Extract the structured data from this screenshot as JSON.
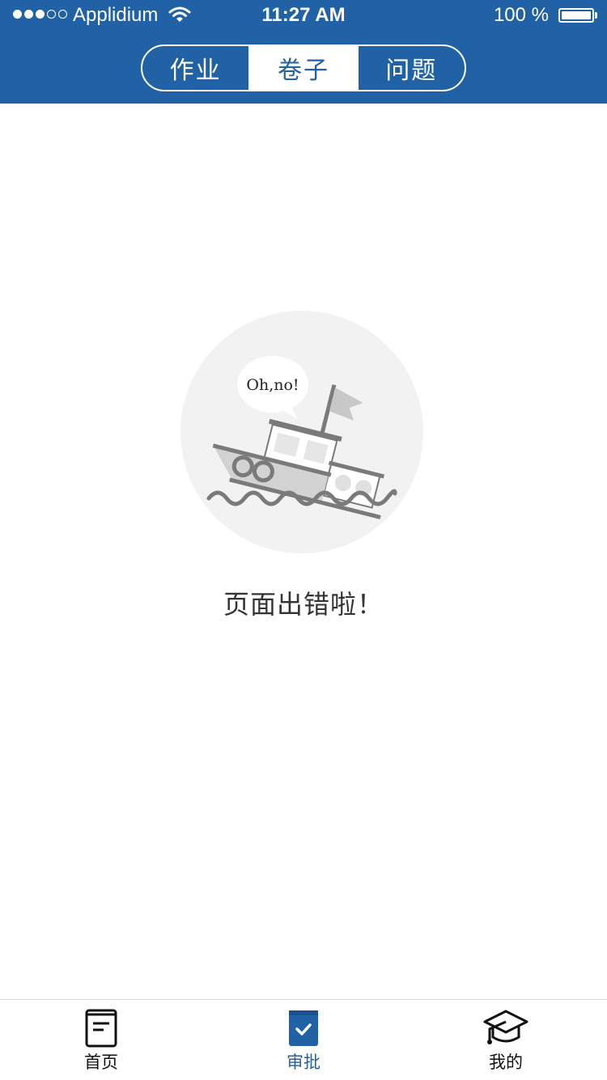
{
  "status_bar": {
    "carrier": "Applidium",
    "time": "11:27 AM",
    "battery": "100 %"
  },
  "segments": [
    {
      "label": "作业",
      "active": false
    },
    {
      "label": "卷子",
      "active": true
    },
    {
      "label": "问题",
      "active": false
    }
  ],
  "illustration": {
    "bubble_text": "Oh,no!",
    "icon": "sinking-boat-icon"
  },
  "error_message": "页面出错啦！",
  "tabbar": {
    "items": [
      {
        "label": "首页",
        "icon": "book-icon",
        "active": false
      },
      {
        "label": "审批",
        "icon": "approval-book-icon",
        "active": true
      },
      {
        "label": "我的",
        "icon": "graduation-cap-icon",
        "active": false
      }
    ]
  },
  "colors": {
    "brand": "#2161a6",
    "background": "#ffffff",
    "illustration_bg": "#f2f2f2"
  }
}
